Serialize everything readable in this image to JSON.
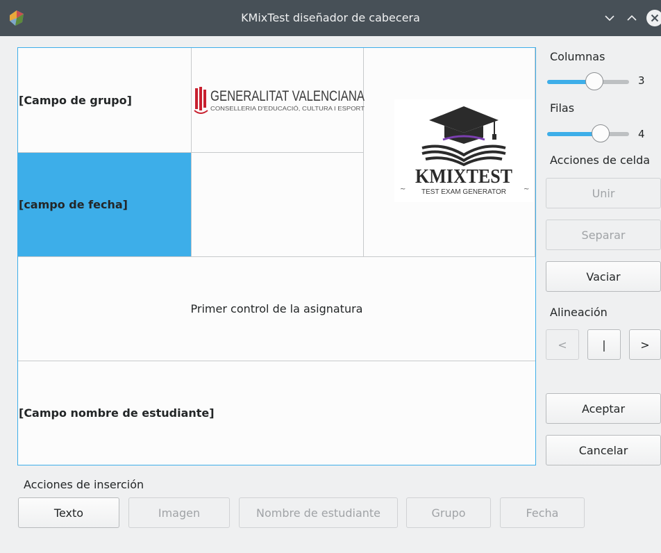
{
  "window": {
    "title": "KMixTest diseñador de cabecera"
  },
  "grid": {
    "cells": {
      "group_field": "[Campo de grupo]",
      "date_field": "[campo de fecha]",
      "subject_text": "Primer control de la asignatura",
      "student_field": "[Campo nombre de estudiante]"
    },
    "logos": {
      "generalitat_title": "GENERALITAT VALENCIANA",
      "generalitat_subtitle": "CONSELLERIA D'EDUCACIÓ, CULTURA I ESPORT",
      "kmixtest_title": "KMIXTEST",
      "kmixtest_subtitle": "TEST EXAM GENERATOR"
    }
  },
  "side_panel": {
    "columns_label": "Columnas",
    "columns_value": "3",
    "columns_level": 0.6,
    "rows_label": "Filas",
    "rows_value": "4",
    "rows_level": 0.7,
    "cell_actions_label": "Acciones de celda",
    "merge_button": "Unir",
    "split_button": "Separar",
    "clear_button": "Vaciar",
    "alignment_label": "Alineación",
    "align_left": "<",
    "align_center": "|",
    "align_right": ">",
    "accept_button": "Aceptar",
    "cancel_button": "Cancelar"
  },
  "insert_actions": {
    "label": "Acciones de inserción",
    "text_button": "Texto",
    "image_button": "Imagen",
    "student_name_button": "Nombre de estudiante",
    "group_button": "Grupo",
    "date_button": "Fecha"
  },
  "colors": {
    "selection": "#3daee9",
    "titlebar": "#475057"
  }
}
